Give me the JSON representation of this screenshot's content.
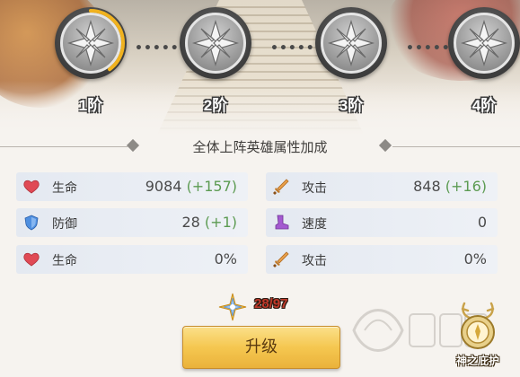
{
  "ranks": [
    {
      "label": "1阶",
      "progress": 0.4
    },
    {
      "label": "2阶",
      "progress": 0
    },
    {
      "label": "3阶",
      "progress": 0
    },
    {
      "label": "4阶",
      "progress": 0
    }
  ],
  "section": {
    "title": "全体上阵英雄属性加成"
  },
  "stats": [
    {
      "icon": "heart-icon",
      "name": "生命",
      "value": "9084",
      "bonus": "(+157)"
    },
    {
      "icon": "sword-icon",
      "name": "攻击",
      "value": "848",
      "bonus": "(+16)"
    },
    {
      "icon": "shield-icon",
      "name": "防御",
      "value": "28",
      "bonus": "(+1)"
    },
    {
      "icon": "boot-icon",
      "name": "速度",
      "value": "0",
      "bonus": ""
    },
    {
      "icon": "heart-icon",
      "name": "生命",
      "value": "0%",
      "bonus": ""
    },
    {
      "icon": "sword-icon",
      "name": "攻击",
      "value": "0%",
      "bonus": ""
    }
  ],
  "upgrade": {
    "progress_text": "28/97",
    "button_label": "升级"
  },
  "protection": {
    "label": "神之庇护"
  },
  "colors": {
    "accent": "#f5c750",
    "bonus": "#5c9b52",
    "progress_ring": "#f0b21f"
  }
}
